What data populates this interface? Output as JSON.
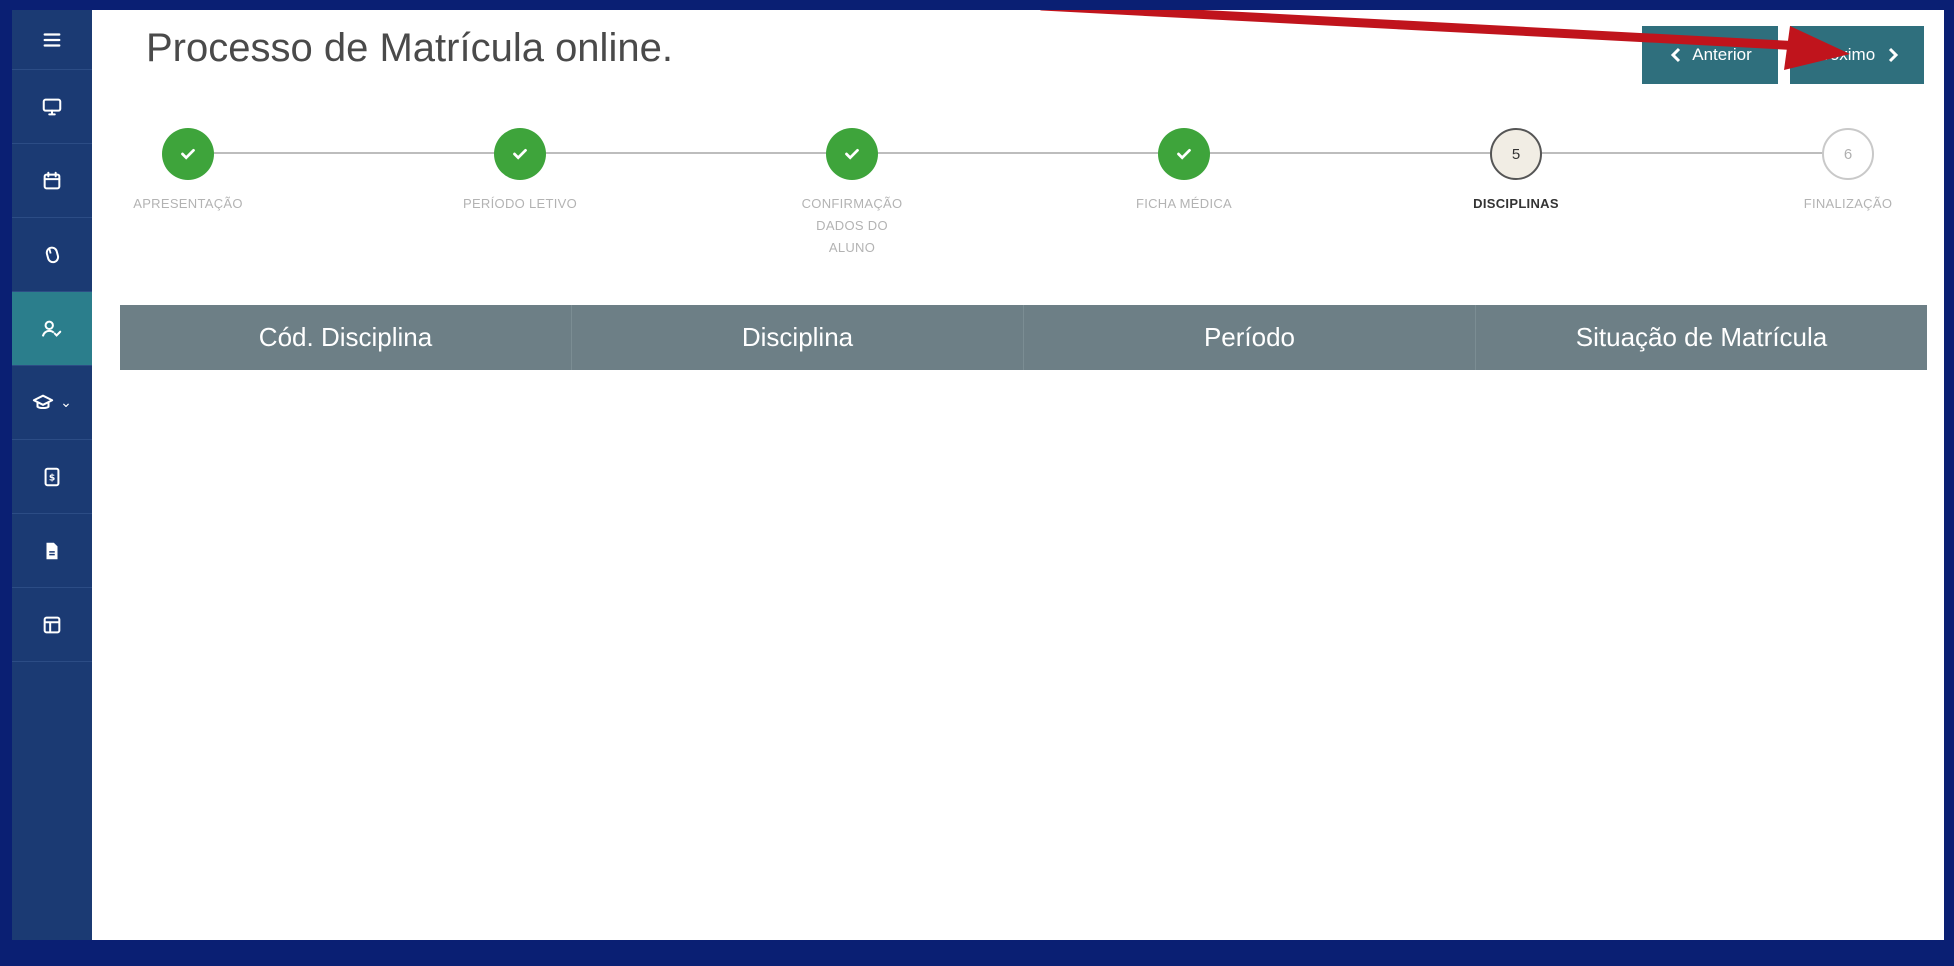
{
  "header": {
    "title": "Processo de Matrícula online.",
    "prev_label": "Anterior",
    "next_label": "Próximo"
  },
  "sidebar": {
    "items": [
      {
        "icon": "menu-icon"
      },
      {
        "icon": "monitor-icon"
      },
      {
        "icon": "calendar-icon"
      },
      {
        "icon": "mouse-icon"
      },
      {
        "icon": "user-check-icon",
        "active": true
      },
      {
        "icon": "graduation-cap-icon",
        "dropdown": true
      },
      {
        "icon": "dollar-document-icon"
      },
      {
        "icon": "file-icon"
      },
      {
        "icon": "layout-icon"
      }
    ]
  },
  "steps": [
    {
      "label": "APRESENTAÇÃO",
      "state": "done"
    },
    {
      "label": "PERÍODO LETIVO",
      "state": "done"
    },
    {
      "label": "CONFIRMAÇÃO DADOS DO ALUNO",
      "state": "done"
    },
    {
      "label": "FICHA MÉDICA",
      "state": "done"
    },
    {
      "label": "DISCIPLINAS",
      "state": "current",
      "number": "5"
    },
    {
      "label": "FINALIZAÇÃO",
      "state": "todo",
      "number": "6"
    }
  ],
  "table": {
    "columns": [
      "Cód. Disciplina",
      "Disciplina",
      "Período",
      "Situação de Matrícula"
    ],
    "rows": []
  },
  "colors": {
    "sidebar": "#1b3a73",
    "sidebar_active": "#2b7e8c",
    "button": "#2f6f7d",
    "step_done": "#3ea43b",
    "table_header": "#6d7f86",
    "frame": "#0a1f73",
    "annotation_arrow": "#c0141c"
  }
}
